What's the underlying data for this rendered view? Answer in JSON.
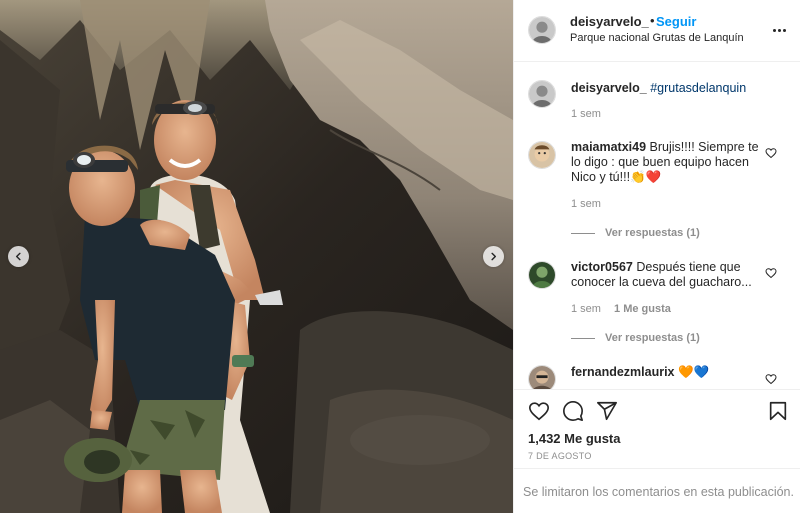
{
  "post": {
    "username": "deisyarvelo_",
    "follow_label": "Seguir",
    "location": "Parque nacional Grutas de Lanquín"
  },
  "caption": {
    "username": "deisyarvelo_",
    "text": "#grutasdelanquin",
    "time": "1 sem"
  },
  "comments": [
    {
      "username": "maiamatxi49",
      "text": "Brujis!!!! Siempre te lo digo : que buen equipo hacen Nico y tú!!!",
      "emoji": "👏❤️",
      "time": "1 sem",
      "replies_label": "Ver respuestas (1)"
    },
    {
      "username": "victor0567",
      "text": "Después tiene que conocer la cueva del guacharo...",
      "time": "1 sem",
      "likes_label": "1 Me gusta",
      "replies_label": "Ver respuestas (1)"
    },
    {
      "username": "fernandezmlaurix",
      "text": "🧡💙"
    }
  ],
  "actions": {
    "likes": "1,432 Me gusta",
    "date": "7 DE AGOSTO",
    "limited_comments": "Se limitaron los comentarios en esta publicación."
  },
  "icons": [
    "heart-icon",
    "comment-icon",
    "share-icon",
    "bookmark-icon",
    "more-options-icon",
    "chevron-left-icon",
    "chevron-right-icon"
  ],
  "colors": {
    "link_blue": "#0095f6",
    "hashtag": "#00376b",
    "muted": "#8e8e8e",
    "text": "#262626"
  }
}
